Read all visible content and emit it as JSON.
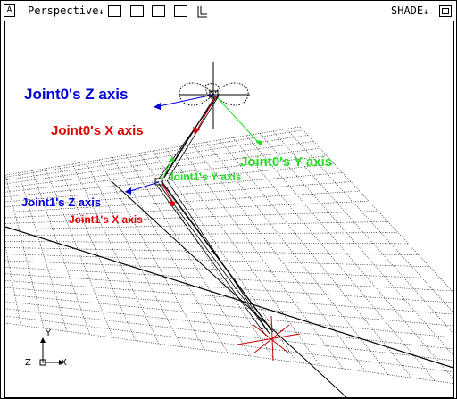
{
  "window": {
    "corner_label": "A",
    "view_mode": "Perspective",
    "shade_mode": "SHADE"
  },
  "labels": {
    "joint0_z": "Joint0's Z axis",
    "joint0_x": "Joint0's X axis",
    "joint0_y": "Joint0's Y axis",
    "joint1_z": "Joint1's Z axis",
    "joint1_y": "Joint1's Y axis",
    "joint1_x": "Joint1's X axis"
  },
  "triad": {
    "y": "Y",
    "z": "Z",
    "x": "X"
  },
  "colors": {
    "z_axis": "#0000d8",
    "x_axis": "#e00000",
    "y_axis": "#20e020",
    "grid": "#000000"
  }
}
